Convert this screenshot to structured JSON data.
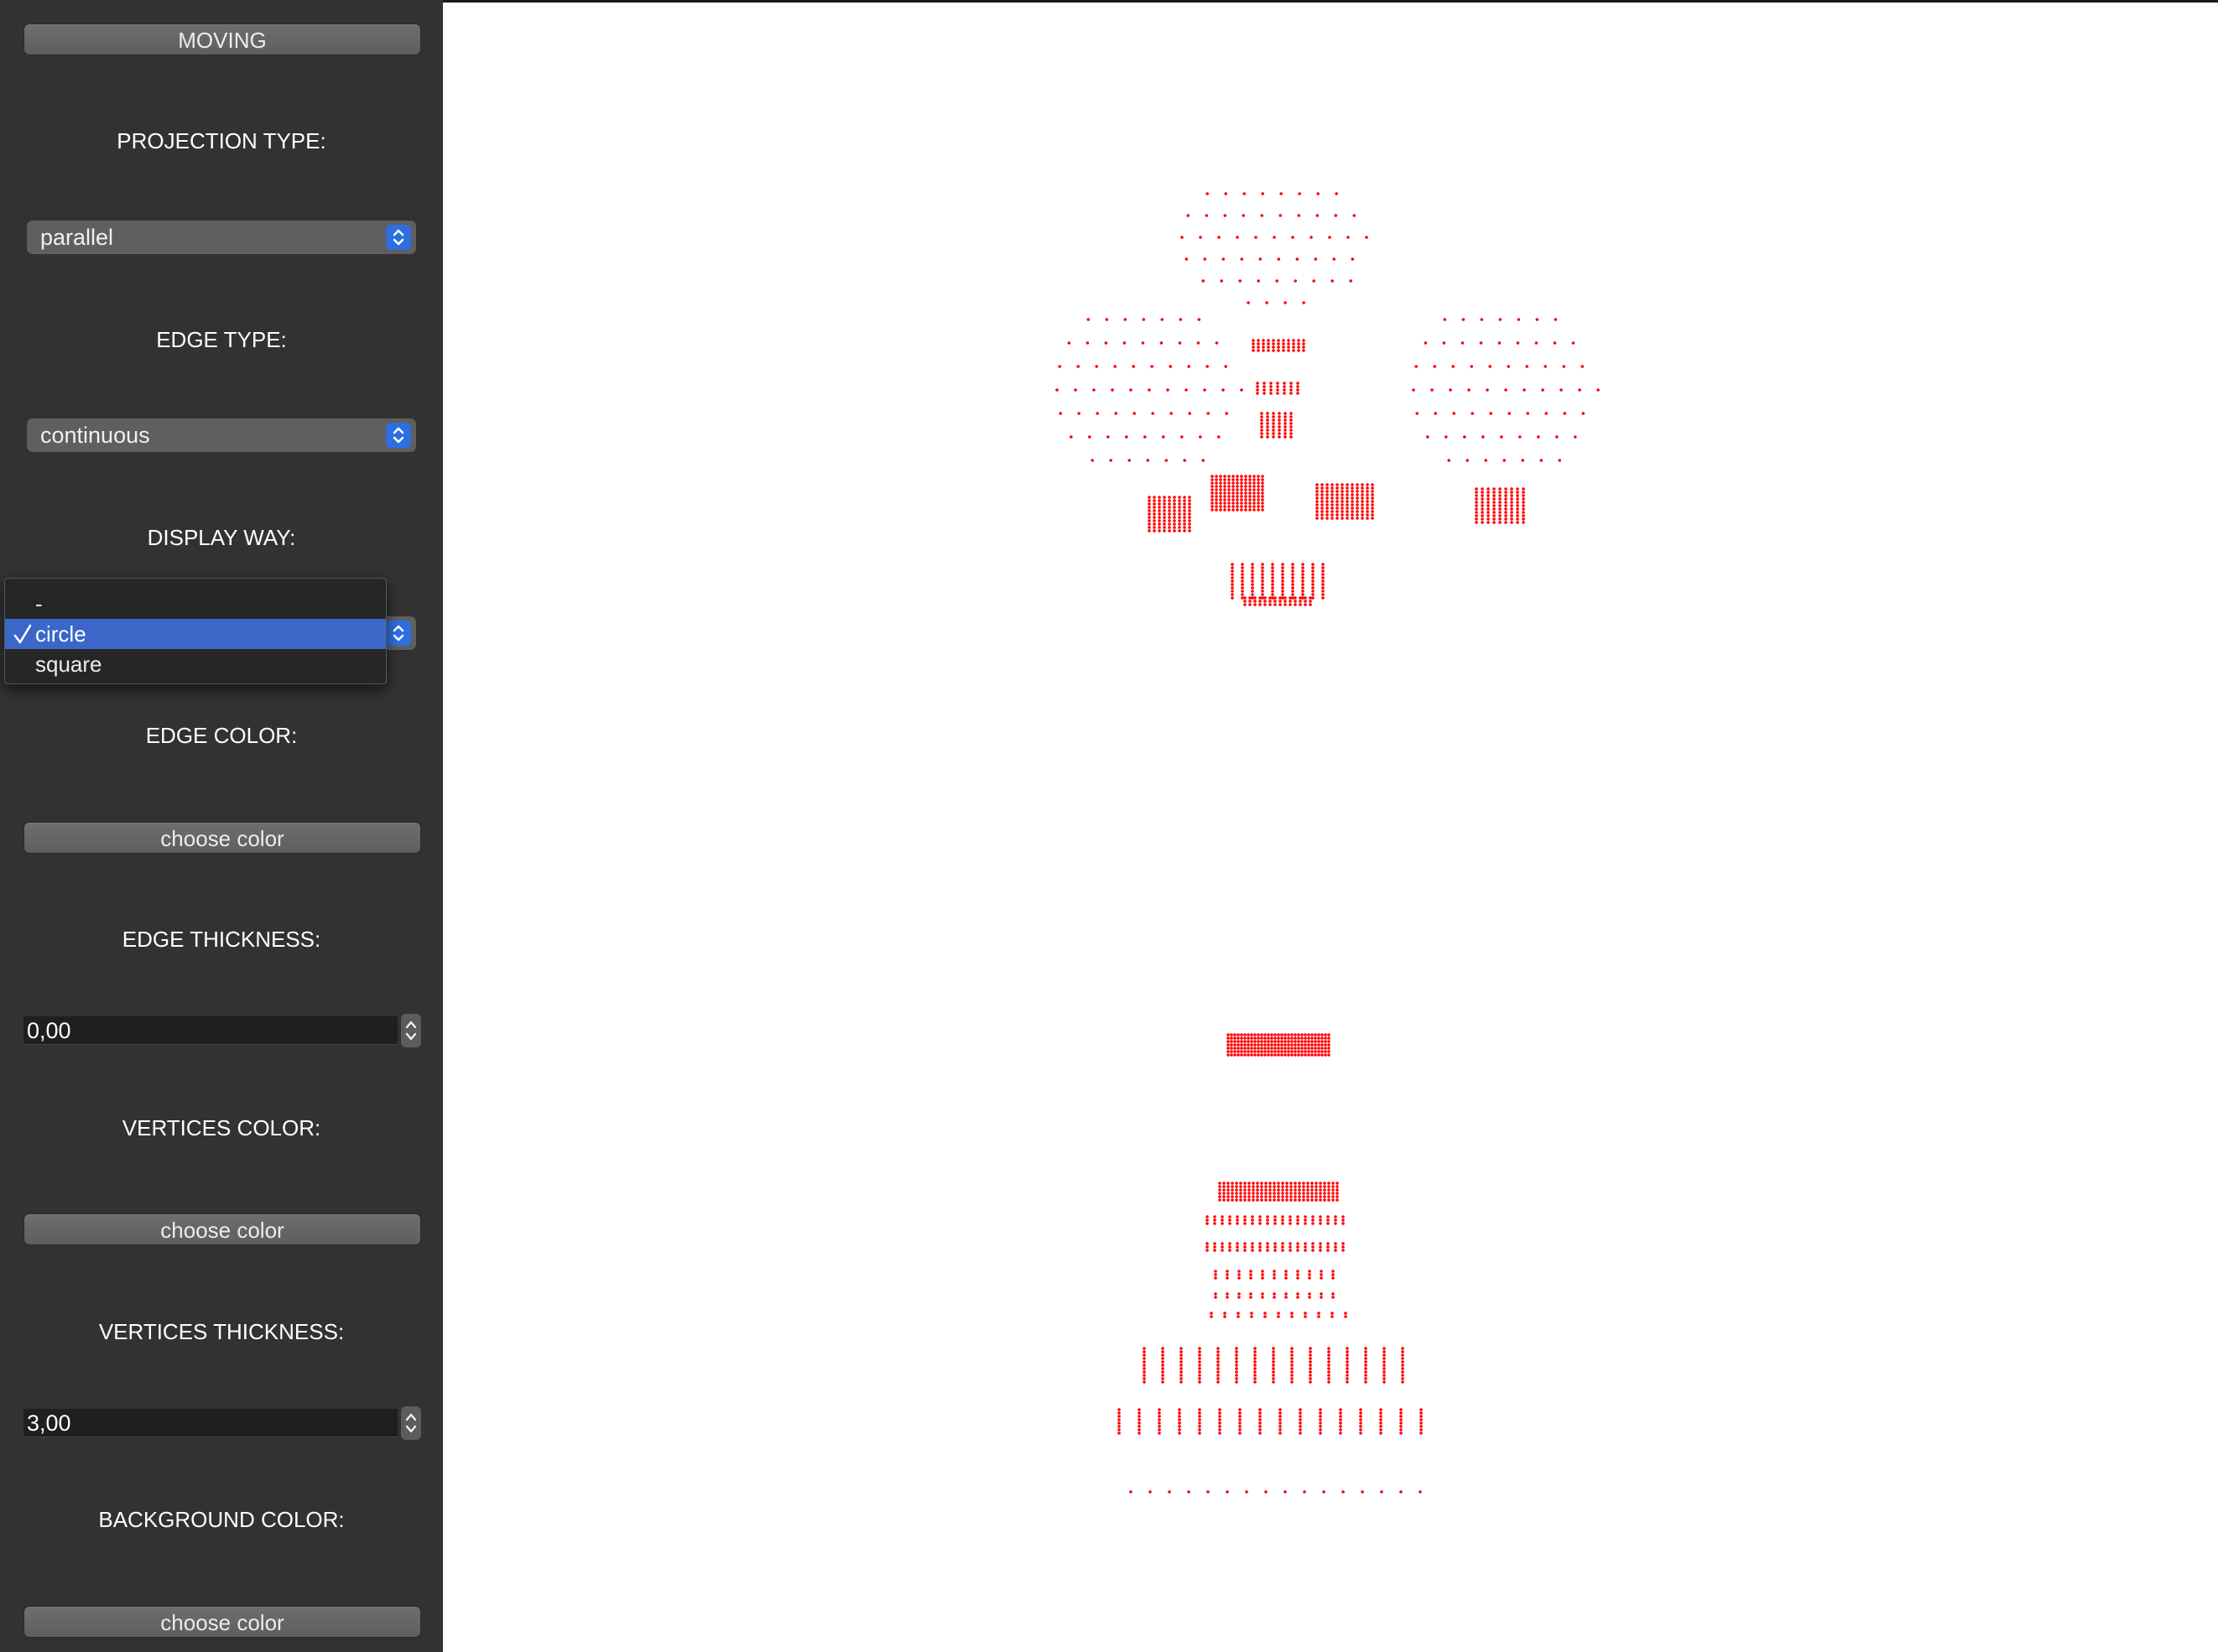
{
  "sidebar": {
    "moving_button": "MOVING",
    "projection_label": "PROJECTION TYPE:",
    "projection_value": "parallel",
    "edge_type_label": "EDGE  TYPE:",
    "edge_type_value": "continuous",
    "display_way_label": "DISPLAY WAY:",
    "display_way_options": [
      "-",
      "circle",
      "square"
    ],
    "display_way_selected": "circle",
    "edge_color_label": "EDGE COLOR:",
    "edge_color_button": "choose color",
    "edge_thickness_label": "EDGE THICKNESS:",
    "edge_thickness_value": "0,00",
    "vertices_color_label": "VERTICES  COLOR:",
    "vertices_color_button": "choose color",
    "vertices_thickness_label": "VERTICES THICKNESS:",
    "vertices_thickness_value": "3,00",
    "background_color_label": "BACKGROUND COLOR:",
    "background_color_button": "choose color"
  },
  "viewport": {
    "background_color": "#ffffff",
    "vertex_color": "#ff0000",
    "icon_names": [
      "chevron-updown-icon",
      "checkmark-icon",
      "stepper-icon"
    ]
  }
}
